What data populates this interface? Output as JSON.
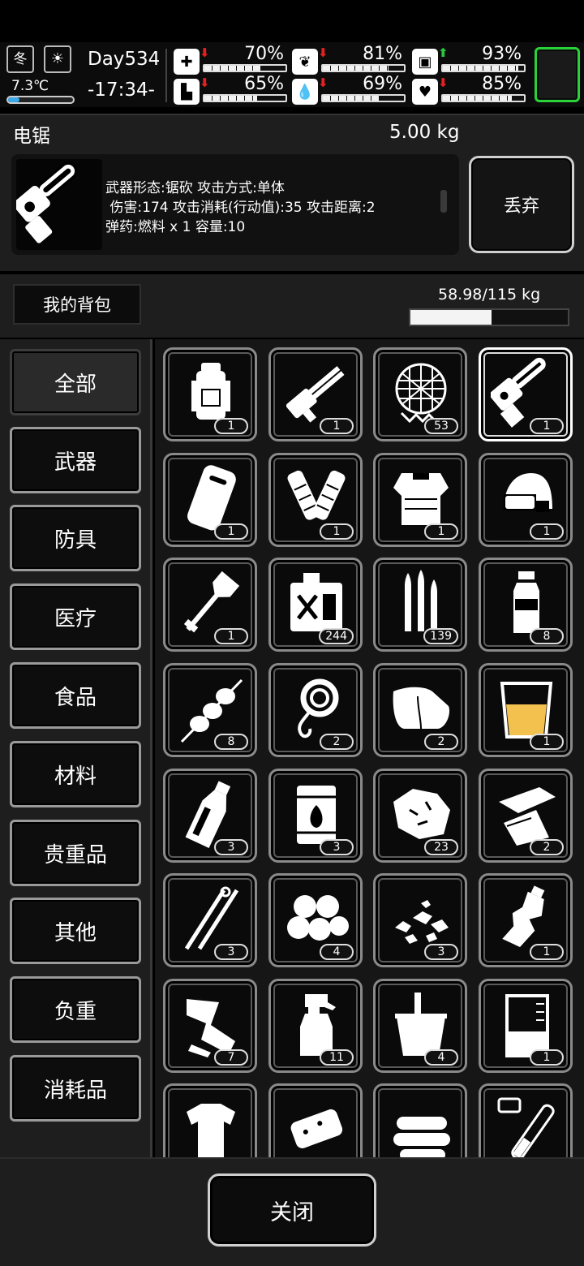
{
  "status": {
    "season_label": "冬",
    "weather": "sun-icon",
    "temperature": "7.3℃",
    "temperature_fill": 0.18,
    "day": "Day534",
    "time": "-17:34-",
    "stats": [
      {
        "name": "health",
        "icon": "medkit-icon",
        "value": "70%",
        "fill": 0.7,
        "trend": "down"
      },
      {
        "name": "hunger",
        "icon": "stomach-icon",
        "value": "81%",
        "fill": 0.81,
        "trend": "down"
      },
      {
        "name": "energy",
        "icon": "battery-icon",
        "value": "93%",
        "fill": 0.93,
        "trend": "up"
      },
      {
        "name": "stamina",
        "icon": "boot-icon",
        "value": "65%",
        "fill": 0.65,
        "trend": "down"
      },
      {
        "name": "thirst",
        "icon": "water-drop-icon",
        "value": "69%",
        "fill": 0.69,
        "trend": "down"
      },
      {
        "name": "mood",
        "icon": "heart-icon",
        "value": "85%",
        "fill": 0.85,
        "trend": "down"
      }
    ]
  },
  "detail": {
    "name": "电锯",
    "weight": "5.00 kg",
    "description": "武器形态:锯砍 攻击方式:单体\n 伤害:174 攻击消耗(行动值):35 攻击距离:2\n弹药:燃料 x 1 容量:10",
    "drop_label": "丢弃"
  },
  "bag": {
    "tab_label": "我的背包",
    "weight_text": "58.98/115 kg",
    "weight_fill": 0.5129
  },
  "categories": [
    "全部",
    "武器",
    "防具",
    "医疗",
    "食品",
    "材料",
    "贵重品",
    "其他",
    "负重",
    "消耗品"
  ],
  "active_category": 0,
  "items": [
    {
      "icon": "backpack-icon",
      "count": "1"
    },
    {
      "icon": "minigun-icon",
      "count": "1"
    },
    {
      "icon": "net-icon",
      "count": "53"
    },
    {
      "icon": "chainsaw-icon",
      "count": "1",
      "selected": true
    },
    {
      "icon": "riot-shield-icon",
      "count": "1"
    },
    {
      "icon": "arm-guards-icon",
      "count": "1"
    },
    {
      "icon": "body-armor-icon",
      "count": "1"
    },
    {
      "icon": "helmet-icon",
      "count": "1"
    },
    {
      "icon": "shovel-icon",
      "count": "1"
    },
    {
      "icon": "fuel-can-icon",
      "count": "244"
    },
    {
      "icon": "bullets-icon",
      "count": "139"
    },
    {
      "icon": "water-bottle-icon",
      "count": "8"
    },
    {
      "icon": "skewer-icon",
      "count": "8"
    },
    {
      "icon": "rope-icon",
      "count": "2"
    },
    {
      "icon": "cloth-icon",
      "count": "2"
    },
    {
      "icon": "juice-cup-icon",
      "count": "1"
    },
    {
      "icon": "glass-bottle-icon",
      "count": "3"
    },
    {
      "icon": "fire-barrel-icon",
      "count": "3"
    },
    {
      "icon": "ore-icon",
      "count": "23"
    },
    {
      "icon": "scrap-paper-icon",
      "count": "2"
    },
    {
      "icon": "tweezers-icon",
      "count": "3"
    },
    {
      "icon": "cotton-balls-icon",
      "count": "4"
    },
    {
      "icon": "gravel-icon",
      "count": "3"
    },
    {
      "icon": "crushed-bottle-icon",
      "count": "1"
    },
    {
      "icon": "rags-icon",
      "count": "7"
    },
    {
      "icon": "spray-bottle-icon",
      "count": "11"
    },
    {
      "icon": "bucket-icon",
      "count": "4"
    },
    {
      "icon": "beaker-icon",
      "count": "1"
    },
    {
      "icon": "torn-shirt-icon",
      "count": ""
    },
    {
      "icon": "soap-icon",
      "count": ""
    },
    {
      "icon": "towels-icon",
      "count": ""
    },
    {
      "icon": "test-tube-icon",
      "count": ""
    }
  ],
  "footer": {
    "close_label": "关闭"
  },
  "colors": {
    "panel": "#1e1e1e",
    "slot_border": "#8a8a8a",
    "juice": "#f2c14e",
    "down_arrow": "#e52020",
    "up_arrow": "#27c93f",
    "active_slot": "#2ad23a"
  }
}
